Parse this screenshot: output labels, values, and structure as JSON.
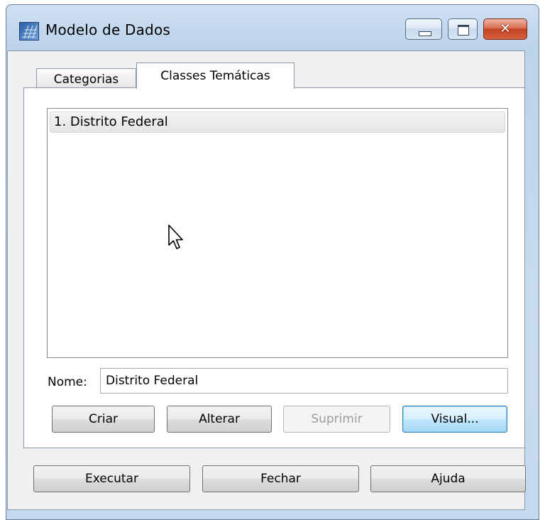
{
  "window": {
    "title": "Modelo de Dados",
    "minimize_glyph": "",
    "maximize_glyph": "",
    "close_glyph": "✕"
  },
  "tabs": [
    {
      "label": "Categorias",
      "active": false
    },
    {
      "label": "Classes Temáticas",
      "active": true
    }
  ],
  "list": {
    "items": [
      "1. Distrito Federal"
    ]
  },
  "form": {
    "nome_label": "Nome:",
    "nome_value": "Distrito Federal"
  },
  "buttons": {
    "criar": "Criar",
    "alterar": "Alterar",
    "suprimir": "Suprimir",
    "visual": "Visual...",
    "executar": "Executar",
    "fechar": "Fechar",
    "ajuda": "Ajuda"
  },
  "icons": {
    "app": "map-grid-icon",
    "cursor": "mouse-pointer-icon"
  },
  "colors": {
    "close_button": "#c2421f",
    "focused_button": "#3c7fb1",
    "disabled_text": "#9b9b9b"
  }
}
